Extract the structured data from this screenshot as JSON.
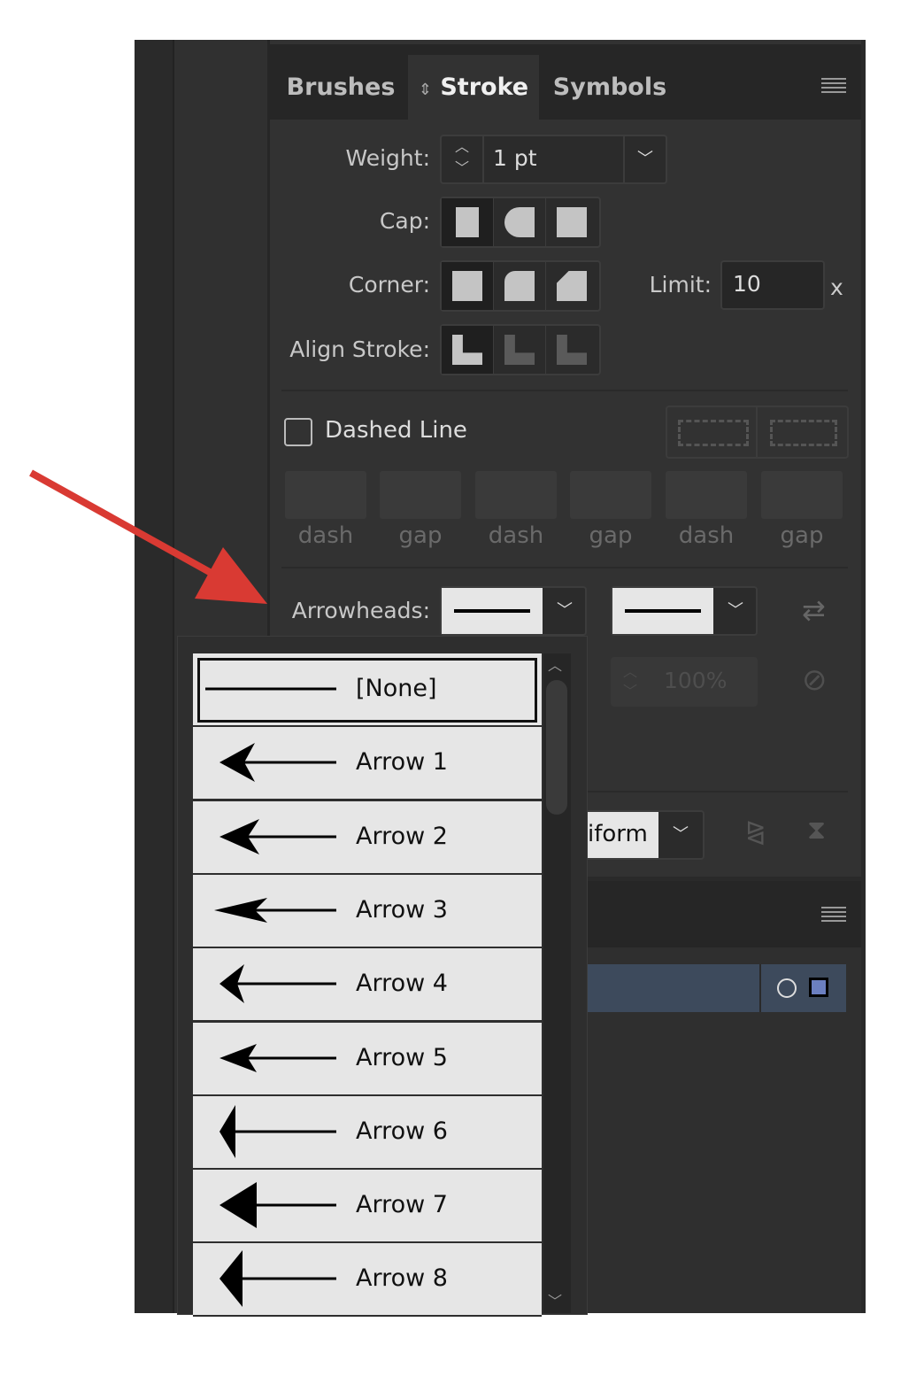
{
  "tabs": [
    "Brushes",
    "Stroke",
    "Symbols"
  ],
  "weight": {
    "label": "Weight:",
    "value": "1 pt"
  },
  "cap": {
    "label": "Cap:"
  },
  "corner": {
    "label": "Corner:",
    "limit_label": "Limit:",
    "limit_value": "10",
    "limit_unit": "x"
  },
  "align": {
    "label": "Align Stroke:"
  },
  "dashed": {
    "label": "Dashed Line",
    "checked": false,
    "fields": [
      "dash",
      "gap",
      "dash",
      "gap",
      "dash",
      "gap"
    ]
  },
  "arrowheads": {
    "label": "Arrowheads:",
    "scale": "100%",
    "profile": "iform"
  },
  "menu": [
    "[None]",
    "Arrow 1",
    "Arrow 2",
    "Arrow 3",
    "Arrow 4",
    "Arrow 5",
    "Arrow 6",
    "Arrow 7",
    "Arrow 8"
  ],
  "colors": {
    "annotation": "#d93a33",
    "selected_row": "#3d4a5c",
    "swatch": "#6b7fc0"
  }
}
